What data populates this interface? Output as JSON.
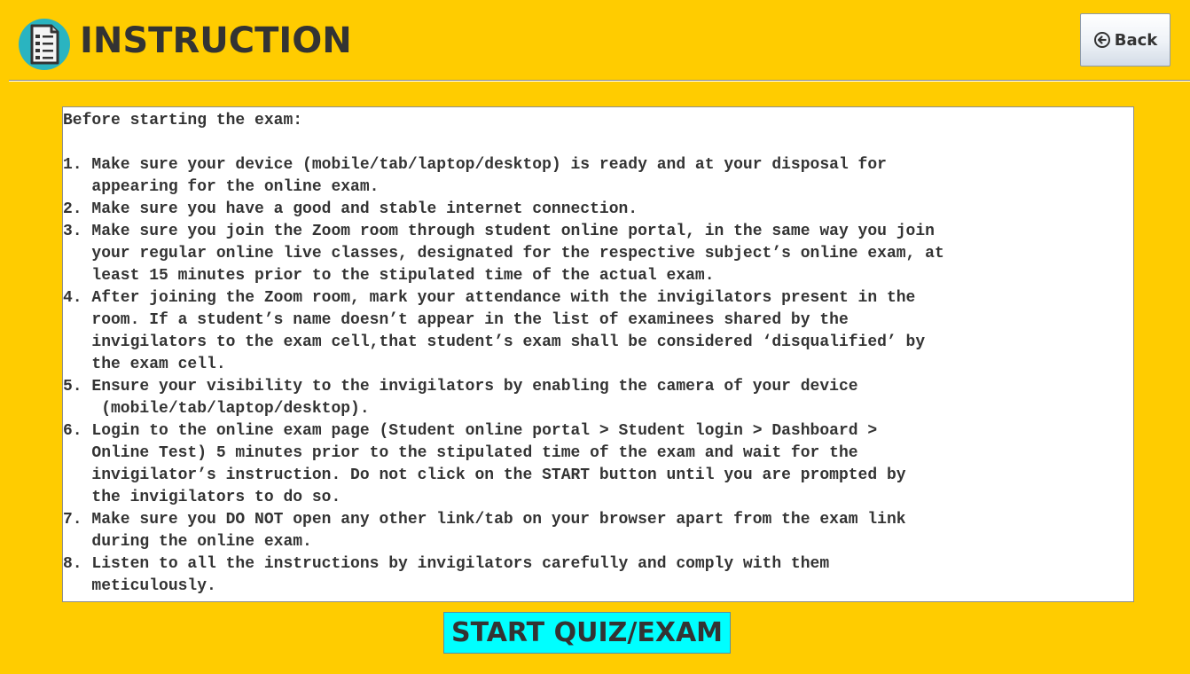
{
  "header": {
    "title": "INSTRUCTION",
    "icon": "document-checklist-icon",
    "back_icon": "circle-arrow-left-icon",
    "back_label": "Back"
  },
  "instructions": {
    "text": "Before starting the exam:\n\n1. Make sure your device (mobile/tab/laptop/desktop) is ready and at your disposal for\n   appearing for the online exam.\n2. Make sure you have a good and stable internet connection.\n3. Make sure you join the Zoom room through student online portal, in the same way you join\n   your regular online live classes, designated for the respective subject’s online exam, at\n   least 15 minutes prior to the stipulated time of the actual exam.\n4. After joining the Zoom room, mark your attendance with the invigilators present in the\n   room. If a student’s name doesn’t appear in the list of examinees shared by the\n   invigilators to the exam cell,that student’s exam shall be considered ‘disqualified’ by\n   the exam cell.\n5. Ensure your visibility to the invigilators by enabling the camera of your device\n    (mobile/tab/laptop/desktop).\n6. Login to the online exam page (Student online portal > Student login > Dashboard >\n   Online Test) 5 minutes prior to the stipulated time of the exam and wait for the\n   invigilator’s instruction. Do not click on the START button until you are prompted by\n   the invigilators to do so.\n7. Make sure you DO NOT open any other link/tab on your browser apart from the exam link\n   during the online exam.\n8. Listen to all the instructions by invigilators carefully and comply with them\n   meticulously."
  },
  "actions": {
    "start_label": "START QUIZ/EXAM"
  },
  "colors": {
    "background": "#ffcc00",
    "start_button": "#00ffff",
    "icon_circle": "#2ab4c0",
    "text": "#333333"
  }
}
